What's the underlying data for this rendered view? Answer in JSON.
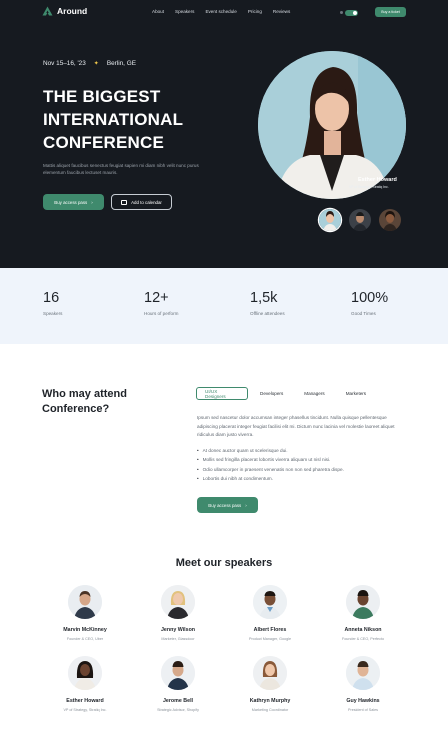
{
  "nav": {
    "brand": "Around",
    "links": [
      "About",
      "Speakers",
      "Event schedule",
      "Pricing",
      "Reviews"
    ],
    "cta": "Buy a ticket"
  },
  "hero": {
    "date": "Nov 15–16, '23",
    "location": "Berlin, GE",
    "title_lines": [
      "THE BIGGEST",
      "INTERNATIONAL",
      "CONFERENCE"
    ],
    "description": "Mattis aliquet faucibus senectus feugiat sapien mi diam nibh velit nunc purus elementum faucibus lectuset mauris.",
    "primary_button": "Buy access pass",
    "secondary_button": "Add to calendar",
    "featured_speaker": {
      "name": "Esther Howard",
      "role": "VP of Strategy, Stratiq Inc."
    }
  },
  "stats": [
    {
      "value": "16",
      "label": "Speakers"
    },
    {
      "value": "12+",
      "label": "Hours of perform"
    },
    {
      "value": "1,5k",
      "label": "Offline attendees"
    },
    {
      "value": "100%",
      "label": "Good Times"
    }
  ],
  "who": {
    "title": "Who may attend Conference?",
    "tabs": [
      "UI/UX Designers",
      "Developers",
      "Managers",
      "Marketers"
    ],
    "active_tab": "UI/UX Designers",
    "description": "Ipsum sed nascetur dolor accumsan integer phasellus tincidunt. Nulla quisque pellentesque adipiscing placerat integer feugiat facilisi elit mi. Dictum nunc lacinia vel molestie laoreet aliquet ridiculus diam justo viverra.",
    "bullets": [
      "At donec auctor quam ut scelerisque dui.",
      "Mollis sed fringilla placerat lobortis viverra aliquam ut nisl nisi.",
      "Odio ullamcorper in praesent venenatis non non sed pharetra dispe.",
      "Lobortis dui nibh at condimentum."
    ],
    "button": "Buy access pass"
  },
  "speakers": {
    "title": "Meet our speakers",
    "list": [
      {
        "name": "Marvin McKinney",
        "role": "Founder & CEO, Uber"
      },
      {
        "name": "Jenny Wilson",
        "role": "Marketer, Glassdoor"
      },
      {
        "name": "Albert Flores",
        "role": "Product Manager, Google"
      },
      {
        "name": "Anneta Nikson",
        "role": "Founder & CEO, Perfecto"
      },
      {
        "name": "Esther Howard",
        "role": "VP of Strategy, Stratiq Inc."
      },
      {
        "name": "Jerome Bell",
        "role": "Strategic Advisor, Shopify"
      },
      {
        "name": "Kathryn Murphy",
        "role": "Marketing Coordinator"
      },
      {
        "name": "Guy Hawkins",
        "role": "President of Sales"
      }
    ]
  },
  "colors": {
    "accent": "#3f8a6d",
    "hero_bg": "#161a20",
    "stats_bg": "#eff4fb"
  }
}
